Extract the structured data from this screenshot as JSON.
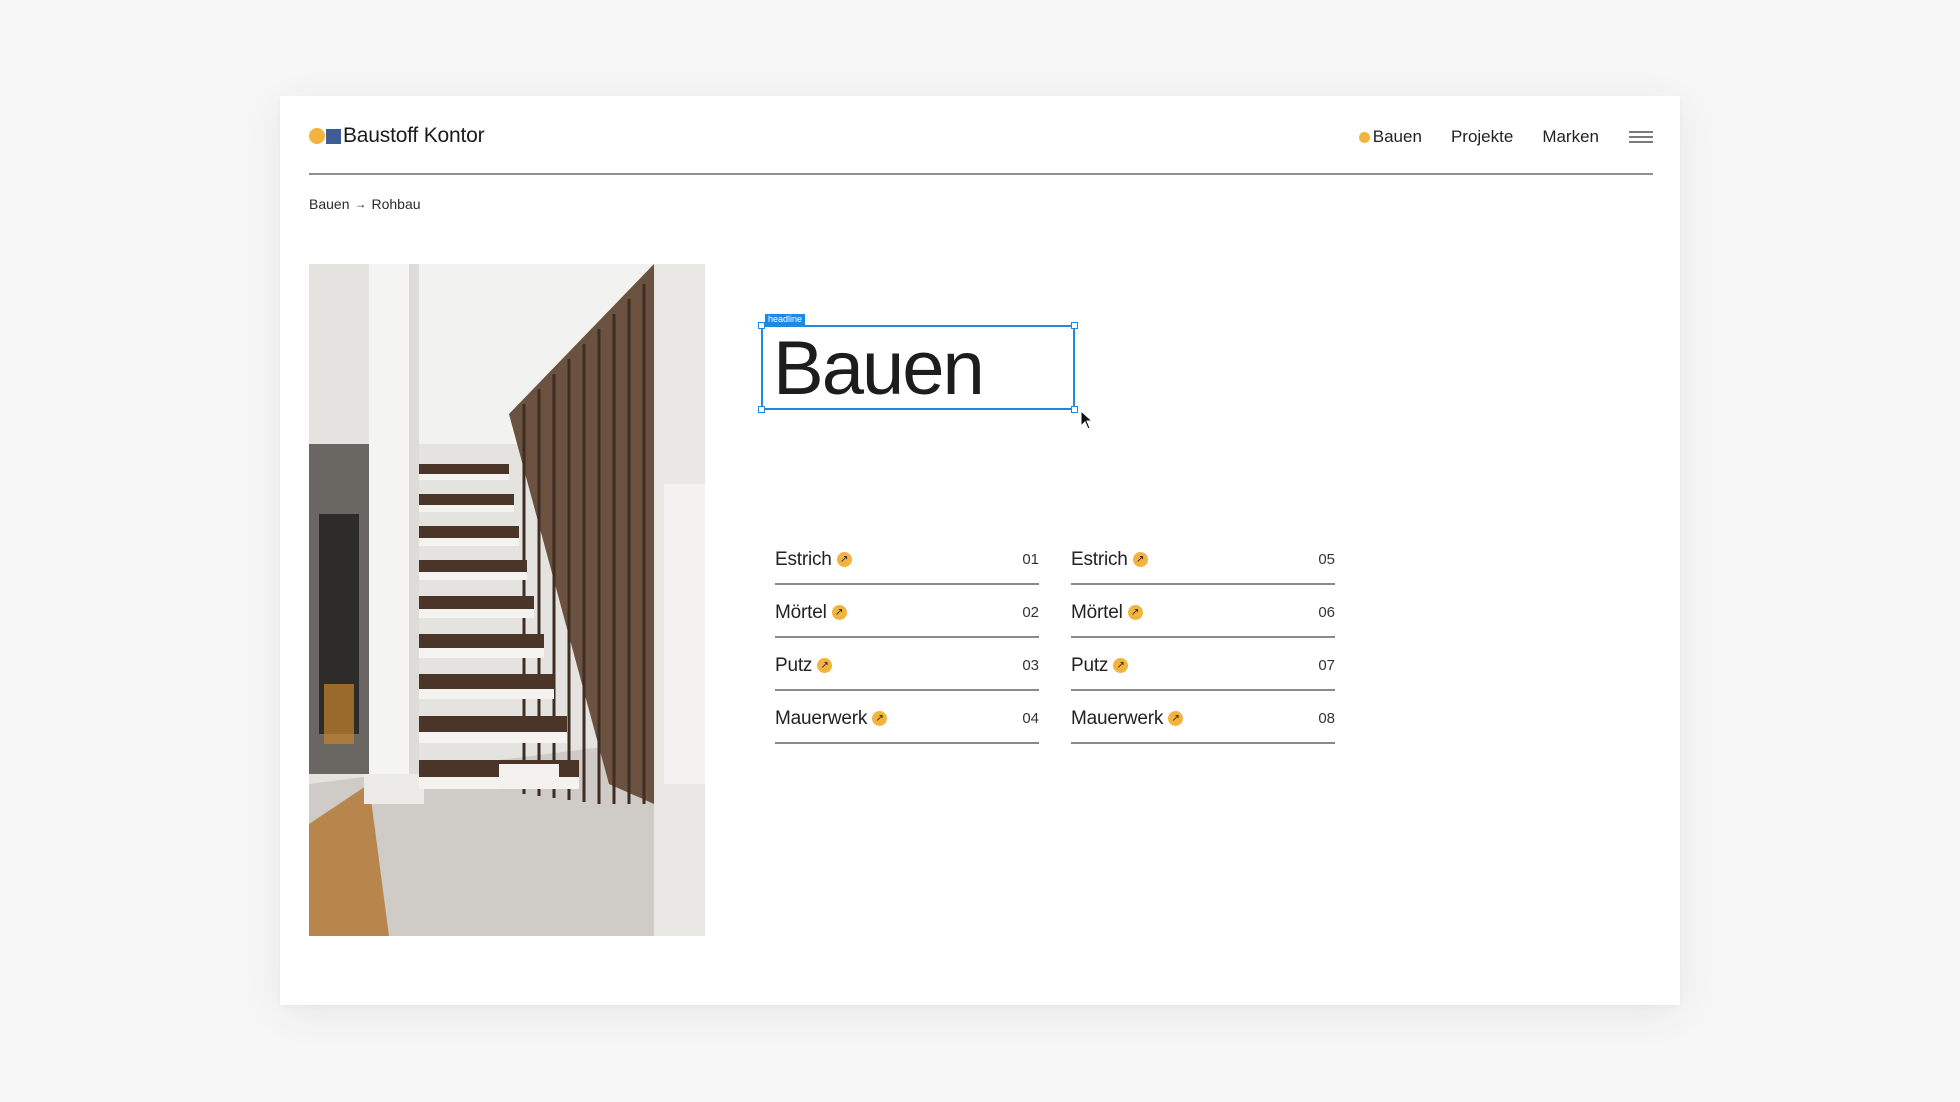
{
  "brand": {
    "name": "Baustoff Kontor",
    "dot_color": "#f3b43e",
    "square_color": "#3e5d95"
  },
  "nav": {
    "items": [
      {
        "label": "Bauen",
        "active": true
      },
      {
        "label": "Projekte"
      },
      {
        "label": "Marken"
      }
    ],
    "menu_icon": "hamburger-icon"
  },
  "breadcrumb": {
    "items": [
      "Bauen",
      "Rohbau"
    ],
    "separator": "→"
  },
  "editor": {
    "selection_tag": "headline",
    "accent": "#1e88e5"
  },
  "headline": "Bauen",
  "list": {
    "arrow_icon": "arrow-up-right-icon",
    "column_1": [
      {
        "label": "Estrich",
        "num": "01"
      },
      {
        "label": "Mörtel",
        "num": "02"
      },
      {
        "label": "Putz",
        "num": "03"
      },
      {
        "label": "Mauerwerk",
        "num": "04"
      }
    ],
    "column_2": [
      {
        "label": "Estrich",
        "num": "05"
      },
      {
        "label": "Mörtel",
        "num": "06"
      },
      {
        "label": "Putz",
        "num": "07"
      },
      {
        "label": "Mauerwerk",
        "num": "08"
      }
    ]
  }
}
